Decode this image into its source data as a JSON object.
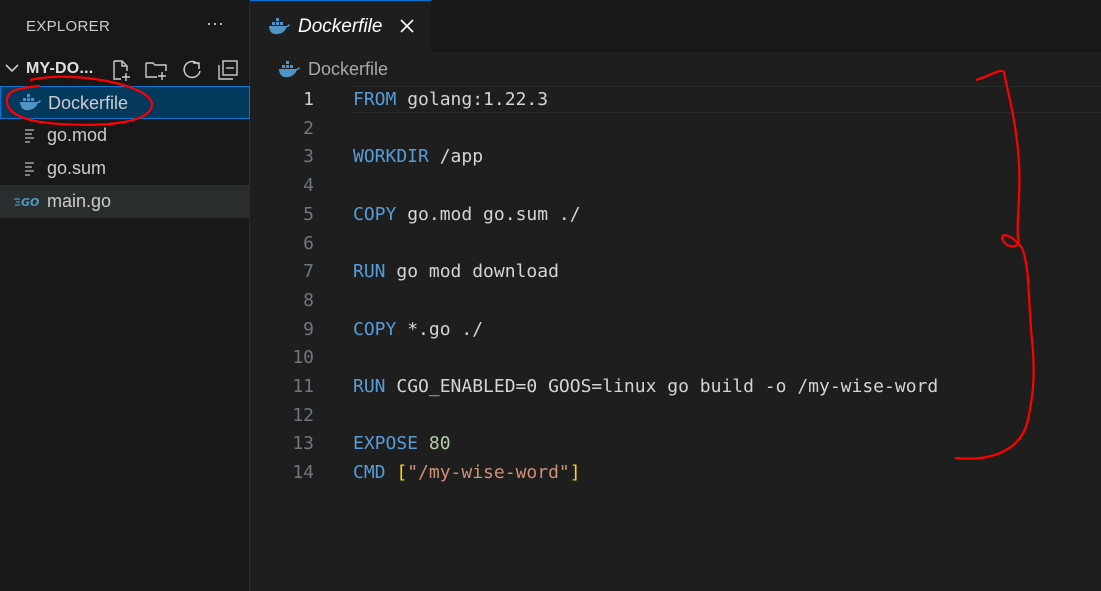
{
  "explorer": {
    "title": "EXPLORER",
    "more_label": "···",
    "folder": {
      "name": "MY-DO..."
    },
    "files": [
      {
        "name": "Dockerfile",
        "icon": "docker-icon"
      },
      {
        "name": "go.mod",
        "icon": "lines-file-icon"
      },
      {
        "name": "go.sum",
        "icon": "lines-file-icon"
      },
      {
        "name": "main.go",
        "icon": "go-file-icon"
      }
    ]
  },
  "editor": {
    "tab": {
      "label": "Dockerfile",
      "close": "✕"
    },
    "breadcrumb": {
      "label": "Dockerfile"
    },
    "active_line": 1,
    "lines": [
      {
        "n": "1",
        "tokens": [
          {
            "t": "FROM",
            "c": "kw"
          },
          {
            "t": " golang:1.22.3",
            "c": ""
          }
        ]
      },
      {
        "n": "2",
        "tokens": []
      },
      {
        "n": "3",
        "tokens": [
          {
            "t": "WORKDIR",
            "c": "kw"
          },
          {
            "t": " /app",
            "c": ""
          }
        ]
      },
      {
        "n": "4",
        "tokens": []
      },
      {
        "n": "5",
        "tokens": [
          {
            "t": "COPY",
            "c": "kw"
          },
          {
            "t": " go.mod go.sum ./",
            "c": ""
          }
        ]
      },
      {
        "n": "6",
        "tokens": []
      },
      {
        "n": "7",
        "tokens": [
          {
            "t": "RUN",
            "c": "kw"
          },
          {
            "t": " go mod download",
            "c": ""
          }
        ]
      },
      {
        "n": "8",
        "tokens": []
      },
      {
        "n": "9",
        "tokens": [
          {
            "t": "COPY",
            "c": "kw"
          },
          {
            "t": " *.go ./",
            "c": ""
          }
        ]
      },
      {
        "n": "10",
        "tokens": []
      },
      {
        "n": "11",
        "tokens": [
          {
            "t": "RUN",
            "c": "kw"
          },
          {
            "t": " CGO_ENABLED=0 GOOS=linux go build -o /my-wise-word",
            "c": ""
          }
        ]
      },
      {
        "n": "12",
        "tokens": []
      },
      {
        "n": "13",
        "tokens": [
          {
            "t": "EXPOSE",
            "c": "kw"
          },
          {
            "t": " ",
            "c": ""
          },
          {
            "t": "80",
            "c": "num"
          }
        ]
      },
      {
        "n": "14",
        "tokens": [
          {
            "t": "CMD",
            "c": "kw"
          },
          {
            "t": " ",
            "c": ""
          },
          {
            "t": "[",
            "c": "br"
          },
          {
            "t": "\"/my-wise-word\"",
            "c": "str"
          },
          {
            "t": "]",
            "c": "br"
          }
        ]
      }
    ]
  },
  "colors": {
    "accent": "#0078d4",
    "keyword": "#569cd6",
    "string": "#ce9178",
    "number": "#b5cea8",
    "bracket": "#ffd700",
    "annotation": "#ff0000"
  }
}
